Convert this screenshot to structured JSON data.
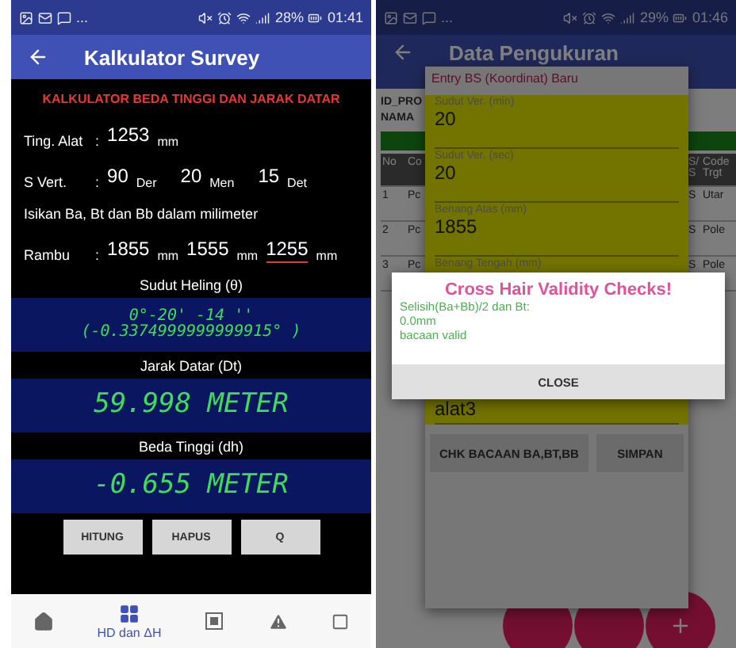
{
  "left_screen": {
    "status_bar": {
      "more": "...",
      "battery": "28%",
      "time": "01:41"
    },
    "app_bar": {
      "title": "Kalkulator Survey"
    },
    "heading": "KALKULATOR BEDA TINGGI DAN JARAK DATAR",
    "tinggi_alat": {
      "label": "Ting. Alat",
      "colon": ":",
      "value": "1253",
      "unit": "mm"
    },
    "sudut_vertikal": {
      "label": "S Vert.",
      "colon": ":",
      "fields": [
        {
          "value": "90",
          "unit": "Der"
        },
        {
          "value": "20",
          "unit": "Men"
        },
        {
          "value": "15",
          "unit": "Det"
        }
      ]
    },
    "instruction": "Isikan Ba, Bt dan Bb dalam milimeter",
    "rambu": {
      "label": "Rambu",
      "colon": ":",
      "fields": [
        {
          "value": "1855",
          "unit": "mm",
          "focused": false
        },
        {
          "value": "1555",
          "unit": "mm",
          "focused": false
        },
        {
          "value": "1255",
          "unit": "mm",
          "focused": true
        }
      ]
    },
    "results": [
      {
        "label": "Sudut Heling (θ)",
        "kind": "small",
        "lines": [
          "0°-20' -14 ''",
          "(-0.3374999999999915° )"
        ]
      },
      {
        "label": "Jarak Datar (Dt)",
        "kind": "large",
        "lines": [
          "59.998 METER"
        ]
      },
      {
        "label": "Beda Tinggi (dh)",
        "kind": "large",
        "lines": [
          "-0.655 METER"
        ]
      }
    ],
    "buttons": [
      "HITUNG",
      "HAPUS",
      "Q"
    ],
    "bottom_nav": [
      {
        "kind": "home",
        "selected": false
      },
      {
        "kind": "grid",
        "label": "HD dan ΔH",
        "selected": true
      },
      {
        "kind": "frame",
        "selected": false
      },
      {
        "kind": "warning",
        "selected": false
      },
      {
        "kind": "square",
        "selected": false
      }
    ]
  },
  "right_screen": {
    "status_bar": {
      "more": "...",
      "battery": "29%",
      "time": "01:46"
    },
    "app_bar": {
      "title": "Data Pengukuran"
    },
    "project_labels": [
      "ID_PRO",
      "NAMA"
    ],
    "table": {
      "columns": [
        "No",
        "Co",
        "S/ S",
        "Code Trgt"
      ],
      "rows": [
        [
          "1",
          "Pc",
          "S",
          "Utar"
        ],
        [
          "2",
          "Pc",
          "S",
          "Pole"
        ],
        [
          "3",
          "Pc",
          "S",
          "Pole"
        ]
      ]
    },
    "dialog": {
      "title": "Entry BS (Koordinat) Baru",
      "fields": [
        {
          "label": "Sudut Ver. (min)",
          "value": "20"
        },
        {
          "label": "Sudut Ver. (sec)",
          "value": "20"
        },
        {
          "label": "Benang Atas (mm)",
          "value": "1855"
        },
        {
          "label": "Benang Tengah (mm)"
        },
        {
          "value": "alat3"
        }
      ],
      "buttons": [
        "CHK BACAAN BA,BT,BB",
        "SIMPAN"
      ]
    },
    "alert": {
      "title": "Cross Hair Validity Checks!",
      "lines": [
        "Selisih(Ba+Bb)/2 dan Bt:",
        "0.0mm",
        "bacaan valid"
      ],
      "button": "CLOSE"
    }
  }
}
